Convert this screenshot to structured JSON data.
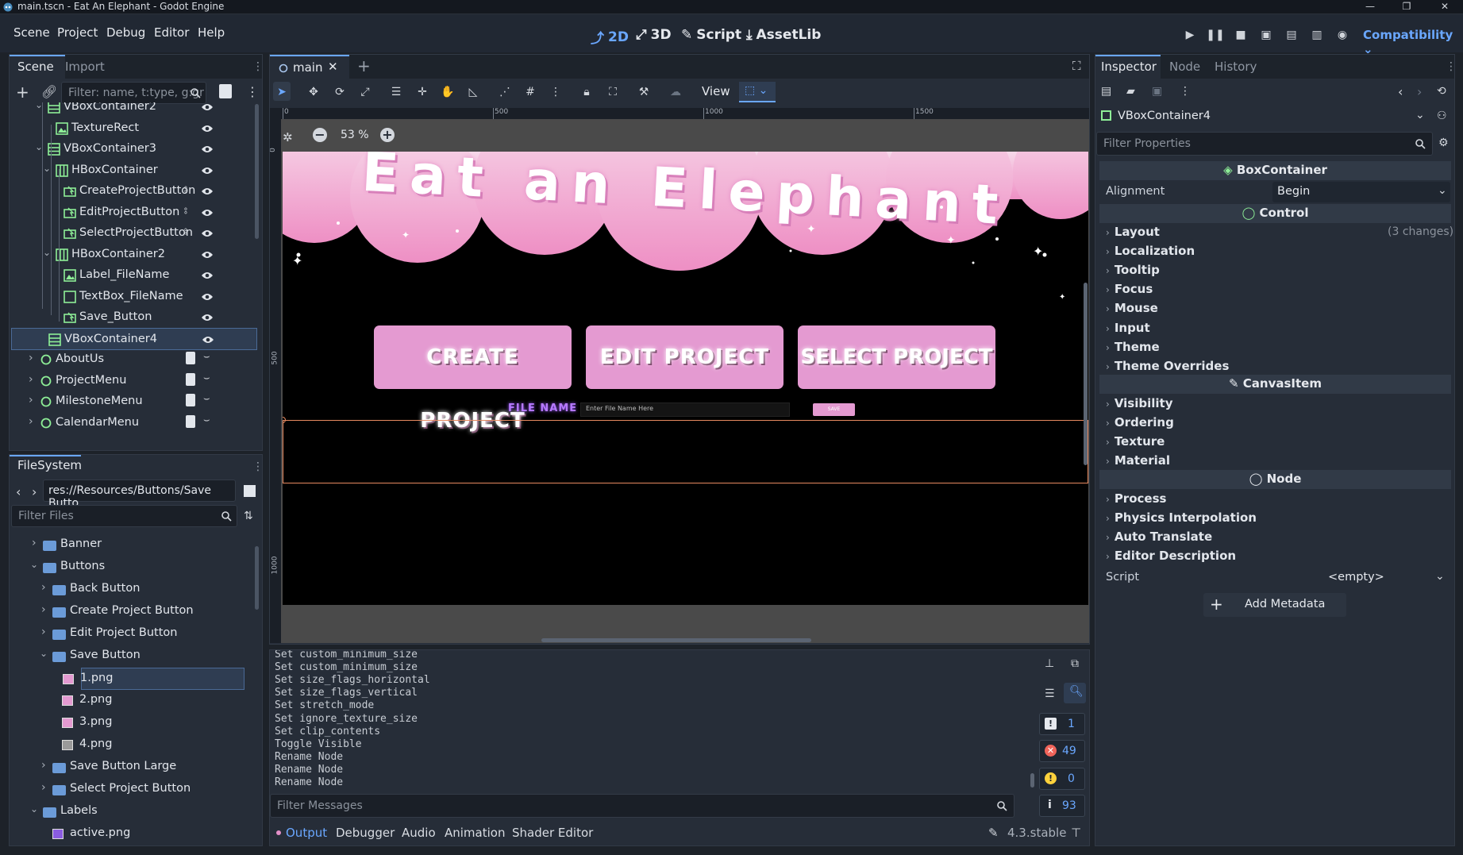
{
  "window": {
    "title": "main.tscn - Eat An Elephant - Godot Engine"
  },
  "menus": [
    "Scene",
    "Project",
    "Debug",
    "Editor",
    "Help"
  ],
  "workspaces": [
    {
      "label": "2D",
      "active": true
    },
    {
      "label": "3D"
    },
    {
      "label": "Script"
    },
    {
      "label": "AssetLib"
    }
  ],
  "renderer": "Compatibility",
  "scene_dock": {
    "tabs": [
      "Scene",
      "Import"
    ],
    "filter_placeholder": "Filter: name, t:type, g:gr",
    "tree": [
      {
        "label": "VBoxContainer2",
        "indent": 1,
        "type": "vbox",
        "expanded": true
      },
      {
        "label": "TextureRect",
        "indent": 2,
        "type": "texture"
      },
      {
        "label": "VBoxContainer3",
        "indent": 1,
        "type": "vbox",
        "expanded": true
      },
      {
        "label": "HBoxContainer",
        "indent": 2,
        "type": "hbox",
        "expanded": true
      },
      {
        "label": "CreateProjectButton",
        "indent": 3,
        "type": "button",
        "signal": true
      },
      {
        "label": "EditProjectButton",
        "indent": 3,
        "type": "button",
        "signal": true
      },
      {
        "label": "SelectProjectButton",
        "indent": 3,
        "type": "button",
        "signal": true
      },
      {
        "label": "HBoxContainer2",
        "indent": 2,
        "type": "hbox",
        "expanded": true
      },
      {
        "label": "Label_FileName",
        "indent": 3,
        "type": "texture"
      },
      {
        "label": "TextBox_FileName",
        "indent": 3,
        "type": "textedit"
      },
      {
        "label": "Save_Button",
        "indent": 3,
        "type": "button"
      },
      {
        "label": "VBoxContainer4",
        "indent": 1,
        "type": "vbox",
        "selected": true
      },
      {
        "label": "AboutUs",
        "indent": 0,
        "type": "control",
        "collapsed": true,
        "script": true
      },
      {
        "label": "ProjectMenu",
        "indent": 0,
        "type": "control",
        "collapsed": true,
        "script": true
      },
      {
        "label": "MilestoneMenu",
        "indent": 0,
        "type": "control",
        "collapsed": true,
        "script": true
      },
      {
        "label": "CalendarMenu",
        "indent": 0,
        "type": "control",
        "collapsed": true,
        "script": true
      }
    ]
  },
  "filesystem": {
    "tab": "FileSystem",
    "path": "res://Resources/Buttons/Save Butto",
    "filter_placeholder": "Filter Files",
    "items": [
      {
        "label": "Banner",
        "indent": 1,
        "type": "folder",
        "collapsed": true
      },
      {
        "label": "Buttons",
        "indent": 1,
        "type": "folder",
        "expanded": true
      },
      {
        "label": "Back Button",
        "indent": 2,
        "type": "folder",
        "collapsed": true
      },
      {
        "label": "Create Project Button",
        "indent": 2,
        "type": "folder",
        "collapsed": true
      },
      {
        "label": "Edit Project Button",
        "indent": 2,
        "type": "folder",
        "collapsed": true
      },
      {
        "label": "Save Button",
        "indent": 2,
        "type": "folder",
        "expanded": true
      },
      {
        "label": "1.png",
        "indent": 3,
        "type": "png-pink",
        "selected": true
      },
      {
        "label": "2.png",
        "indent": 3,
        "type": "png-pink"
      },
      {
        "label": "3.png",
        "indent": 3,
        "type": "png-pink"
      },
      {
        "label": "4.png",
        "indent": 3,
        "type": "png-grey"
      },
      {
        "label": "Save Button Large",
        "indent": 2,
        "type": "folder",
        "collapsed": true
      },
      {
        "label": "Select Project Button",
        "indent": 2,
        "type": "folder",
        "collapsed": true
      },
      {
        "label": "Labels",
        "indent": 1,
        "type": "folder",
        "expanded": true
      },
      {
        "label": "active.png",
        "indent": 2,
        "type": "png-purple"
      }
    ]
  },
  "viewport": {
    "tab": "main",
    "view_label": "View",
    "zoom": "53 %",
    "ruler": [
      "0",
      "500",
      "1000",
      "1500"
    ],
    "ruler_v": [
      "0",
      "500",
      "1000"
    ],
    "game": {
      "title": "Eat an Elephant",
      "buttons": [
        "CREATE PROJECT",
        "EDIT PROJECT",
        "SELECT PROJECT"
      ],
      "file_label": "FILE NAME",
      "file_placeholder": "Enter File Name Here",
      "save_label": "SAVE"
    }
  },
  "output": {
    "lines": [
      "Set custom_minimum_size",
      "Set custom_minimum_size",
      "Set size_flags_horizontal",
      "Set size_flags_vertical",
      "Set stretch_mode",
      "Set ignore_texture_size",
      "Set clip_contents",
      "Toggle Visible",
      "Rename Node",
      "Rename Node",
      "Rename Node"
    ],
    "filter_placeholder": "Filter Messages",
    "counts": {
      "messages": "1",
      "errors": "49",
      "warnings": "0",
      "info": "93"
    },
    "tabs": [
      "Output",
      "Debugger",
      "Audio",
      "Animation",
      "Shader Editor"
    ],
    "version": "4.3.stable"
  },
  "inspector": {
    "tabs": [
      "Inspector",
      "Node",
      "History"
    ],
    "node": "VBoxContainer4",
    "filter_placeholder": "Filter Properties",
    "boxcontainer": {
      "title": "BoxContainer",
      "alignment_label": "Alignment",
      "alignment_value": "Begin"
    },
    "control": {
      "title": "Control",
      "items": [
        "Layout",
        "Localization",
        "Tooltip",
        "Focus",
        "Mouse",
        "Input",
        "Theme",
        "Theme Overrides"
      ],
      "layout_changes": "(3 changes)"
    },
    "canvasitem": {
      "title": "CanvasItem",
      "items": [
        "Visibility",
        "Ordering",
        "Texture",
        "Material"
      ]
    },
    "nodesec": {
      "title": "Node",
      "items": [
        "Process",
        "Physics Interpolation",
        "Auto Translate",
        "Editor Description"
      ]
    },
    "script_label": "Script",
    "script_value": "<empty>",
    "add_metadata": "Add Metadata"
  },
  "colors": {
    "accent": "#6aa7ff",
    "pink": "#e38fc8",
    "selection": "#4a6a96"
  }
}
